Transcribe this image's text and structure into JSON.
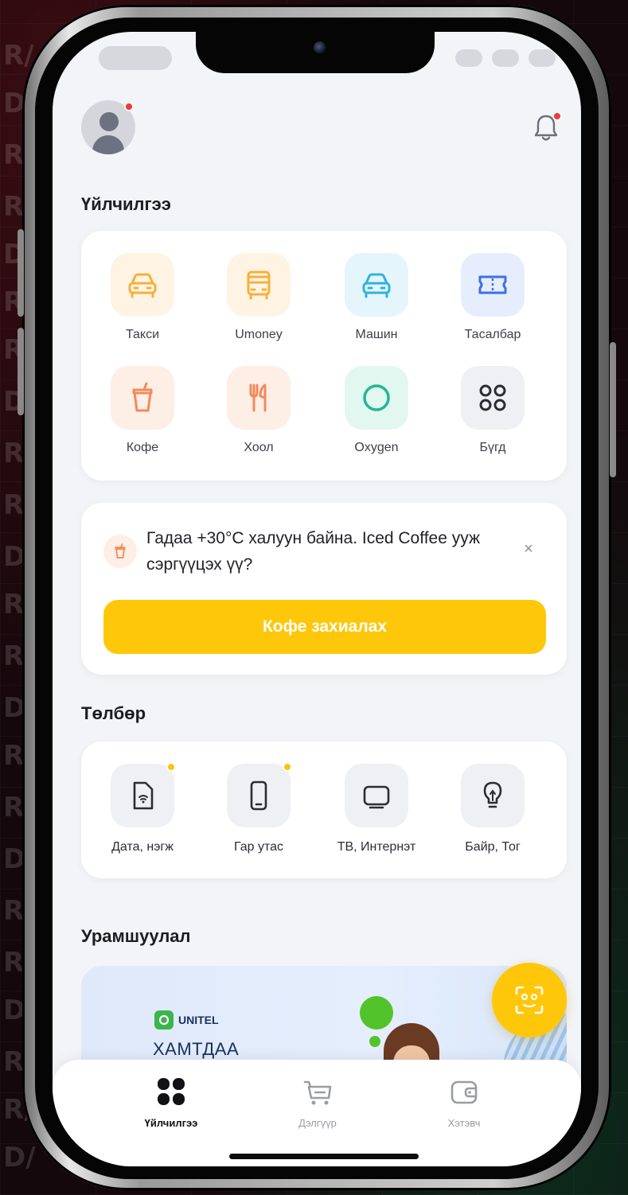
{
  "header": {
    "avatar_alt": "profile avatar",
    "has_notification": true
  },
  "services": {
    "title": "Үйлчилгээ",
    "items": [
      {
        "label": "Такси",
        "icon": "taxi-icon",
        "bg": "#fff4e3",
        "color": "#f6b03c"
      },
      {
        "label": "Umoney",
        "icon": "bus-icon",
        "bg": "#fff4e3",
        "color": "#f6b03c"
      },
      {
        "label": "Машин",
        "icon": "car-icon",
        "bg": "#e4f5fb",
        "color": "#2fb3dc"
      },
      {
        "label": "Тасалбар",
        "icon": "ticket-icon",
        "bg": "#e6eefd",
        "color": "#3f6fe8"
      },
      {
        "label": "Кофе",
        "icon": "coffee-cup-icon",
        "bg": "#fdeee6",
        "color": "#f28a5b"
      },
      {
        "label": "Хоол",
        "icon": "fork-knife-icon",
        "bg": "#fdeee6",
        "color": "#f28a5b"
      },
      {
        "label": "Oxygen",
        "icon": "oxygen-ring-icon",
        "bg": "#e3f7f1",
        "color": "#22b892"
      },
      {
        "label": "Бүгд",
        "icon": "grid-icon",
        "bg": "#eff0f3",
        "color": "#2b2d35"
      }
    ]
  },
  "suggestion": {
    "text": "Гадаа +30°С халуун байна. Iced Coffee ууж сэргүүцэх үү?",
    "close": "×",
    "cta_label": "Кофе захиалах"
  },
  "payments": {
    "title": "Төлбөр",
    "items": [
      {
        "label": "Дата, нэгж",
        "icon": "sim-data-icon",
        "badge": true
      },
      {
        "label": "Гар утас",
        "icon": "mobile-phone-icon",
        "badge": true
      },
      {
        "label": "ТВ, Интернэт",
        "icon": "tv-icon",
        "badge": false
      },
      {
        "label": "Байр, Тог",
        "icon": "light-bulb-icon",
        "badge": false
      }
    ]
  },
  "promotions": {
    "title": "Урамшуулал",
    "banner_brand": "UNITEL",
    "banner_headline": "ХАМТДАА"
  },
  "tabbar": {
    "items": [
      {
        "label": "Үйлчилгээ",
        "icon": "services-grid-icon",
        "active": true
      },
      {
        "label": "Дэлгүүр",
        "icon": "shop-cart-icon",
        "active": false
      },
      {
        "label": "Хэтэвч",
        "icon": "wallet-icon",
        "active": false
      }
    ]
  },
  "colors": {
    "accent": "#ffc70a",
    "badge_red": "#ef3b3b",
    "badge_yellow": "#ffc20e",
    "screen_bg": "#f3f4f8"
  }
}
